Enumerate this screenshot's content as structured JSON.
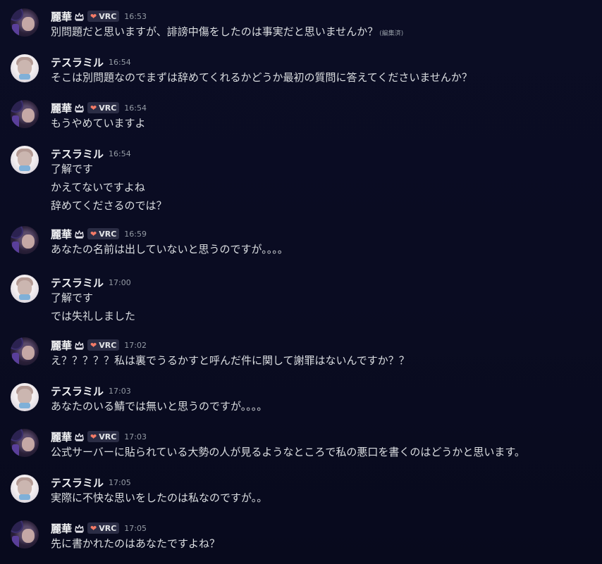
{
  "users": {
    "a": {
      "name": "麗華",
      "tag": "VRC"
    },
    "b": {
      "name": "テスラミル"
    }
  },
  "messages": [
    {
      "user": "a",
      "time": "16:53",
      "lines": [
        "別問題だと思いますが、誹謗中傷をしたのは事実だと思いませんか？"
      ],
      "edited": "(編集済)"
    },
    {
      "user": "b",
      "time": "16:54",
      "lines": [
        "そこは別問題なのでまずは辞めてくれるかどうか最初の質問に答えてくださいませんか？"
      ]
    },
    {
      "user": "a",
      "time": "16:54",
      "lines": [
        "もうやめていますよ"
      ]
    },
    {
      "user": "b",
      "time": "16:54",
      "lines": [
        "了解です",
        "かえてないですよね",
        "辞めてくださるのでは？"
      ]
    },
    {
      "user": "a",
      "time": "16:59",
      "lines": [
        "あなたの名前は出していないと思うのですが。。。。"
      ]
    },
    {
      "user": "b",
      "time": "17:00",
      "lines": [
        "了解です",
        "では失礼しました"
      ]
    },
    {
      "user": "a",
      "time": "17:02",
      "lines": [
        "え？？？？？私は裏でうるかすと呼んだ件に関して謝罪はないんですか？？"
      ]
    },
    {
      "user": "b",
      "time": "17:03",
      "lines": [
        "あなたのいる鯖では無いと思うのですが。。。。"
      ]
    },
    {
      "user": "a",
      "time": "17:03",
      "lines": [
        "公式サーバーに貼られている大勢の人が見るようなところで私の悪口を書くのはどうかと思います。"
      ]
    },
    {
      "user": "b",
      "time": "17:05",
      "lines": [
        "実際に不快な思いをしたのは私なのですが。。"
      ]
    },
    {
      "user": "a",
      "time": "17:05",
      "lines": [
        "先に書かれたのはあなたですよね？"
      ]
    }
  ],
  "colors": {
    "background": "#0a0c22",
    "name": "#f2f3f5",
    "text": "#dbdee1",
    "timestamp": "#949ba4",
    "heart": "#f47b67",
    "tag_bg": "#2b2d45"
  },
  "icons": {
    "crown": "crown-icon",
    "heart": "heart-icon"
  }
}
